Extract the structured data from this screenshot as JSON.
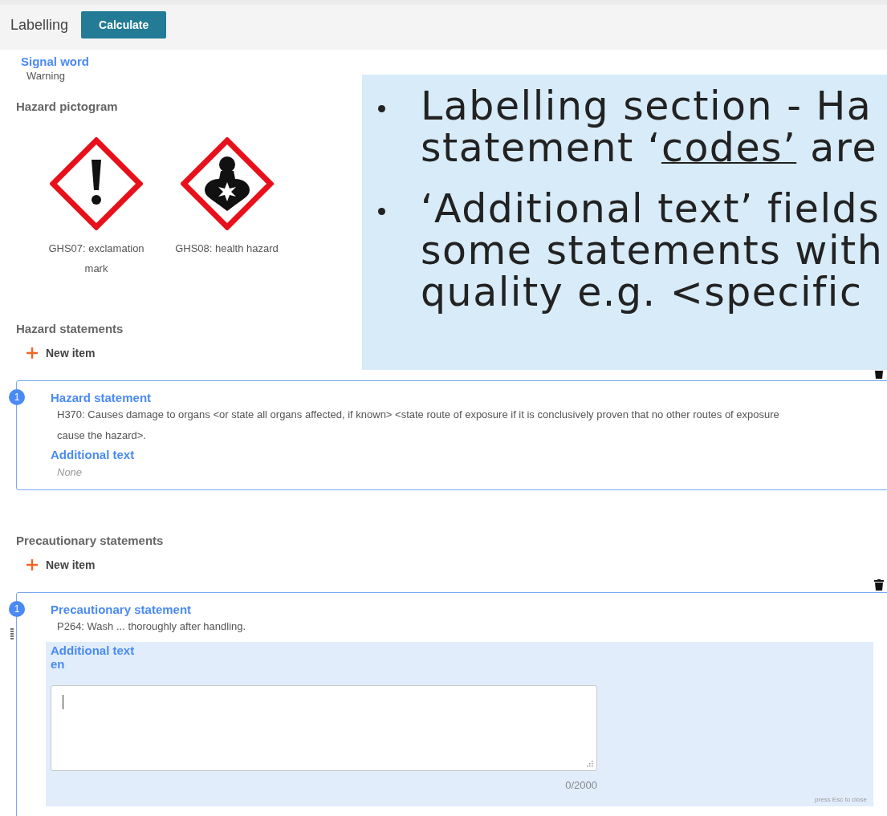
{
  "header": {
    "title": "Labelling",
    "button": "Calculate"
  },
  "signal_word": {
    "label": "Signal word",
    "value": "Warning"
  },
  "hazard_pictogram": {
    "label": "Hazard pictogram",
    "items": [
      {
        "kind": "exclamation",
        "caption": "GHS07: exclamation mark"
      },
      {
        "kind": "health",
        "caption": "GHS08: health hazard"
      }
    ]
  },
  "sections": [
    {
      "title": "Hazard statements",
      "new_item": "New item",
      "items": [
        {
          "number": "1",
          "label": "Hazard statement",
          "value": "H370: Causes damage to organs <or state all organs affected, if known> <state route of exposure if it is conclusively proven that no other routes of exposure cause the hazard>.",
          "additional_label": "Additional text",
          "editing": false,
          "additional_value": "None"
        }
      ]
    },
    {
      "title": "Precautionary statements",
      "new_item": "New item",
      "items": [
        {
          "number": "1",
          "label": "Precautionary statement",
          "value": "P264: Wash ... thoroughly after handling.",
          "additional_label": "Additional text",
          "editing": true,
          "language": "en",
          "counter": "0/2000",
          "hint": "press Esc to close"
        }
      ]
    }
  ],
  "callout": {
    "bullets": [
      {
        "lines": [
          [
            {
              "text": "Labelling section - Ha",
              "underlined": false
            }
          ],
          [
            {
              "text": "statement ‘",
              "underlined": false
            },
            {
              "text": "codes’",
              "underlined": true
            },
            {
              "text": " are",
              "underlined": false
            }
          ]
        ]
      },
      {
        "lines": [
          [
            {
              "text": "‘Additional text’ fields",
              "underlined": false
            }
          ],
          [
            {
              "text": "some statements with",
              "underlined": false
            }
          ],
          [
            {
              "text": "quality e.g. <specific",
              "underlined": false
            }
          ]
        ]
      }
    ]
  }
}
